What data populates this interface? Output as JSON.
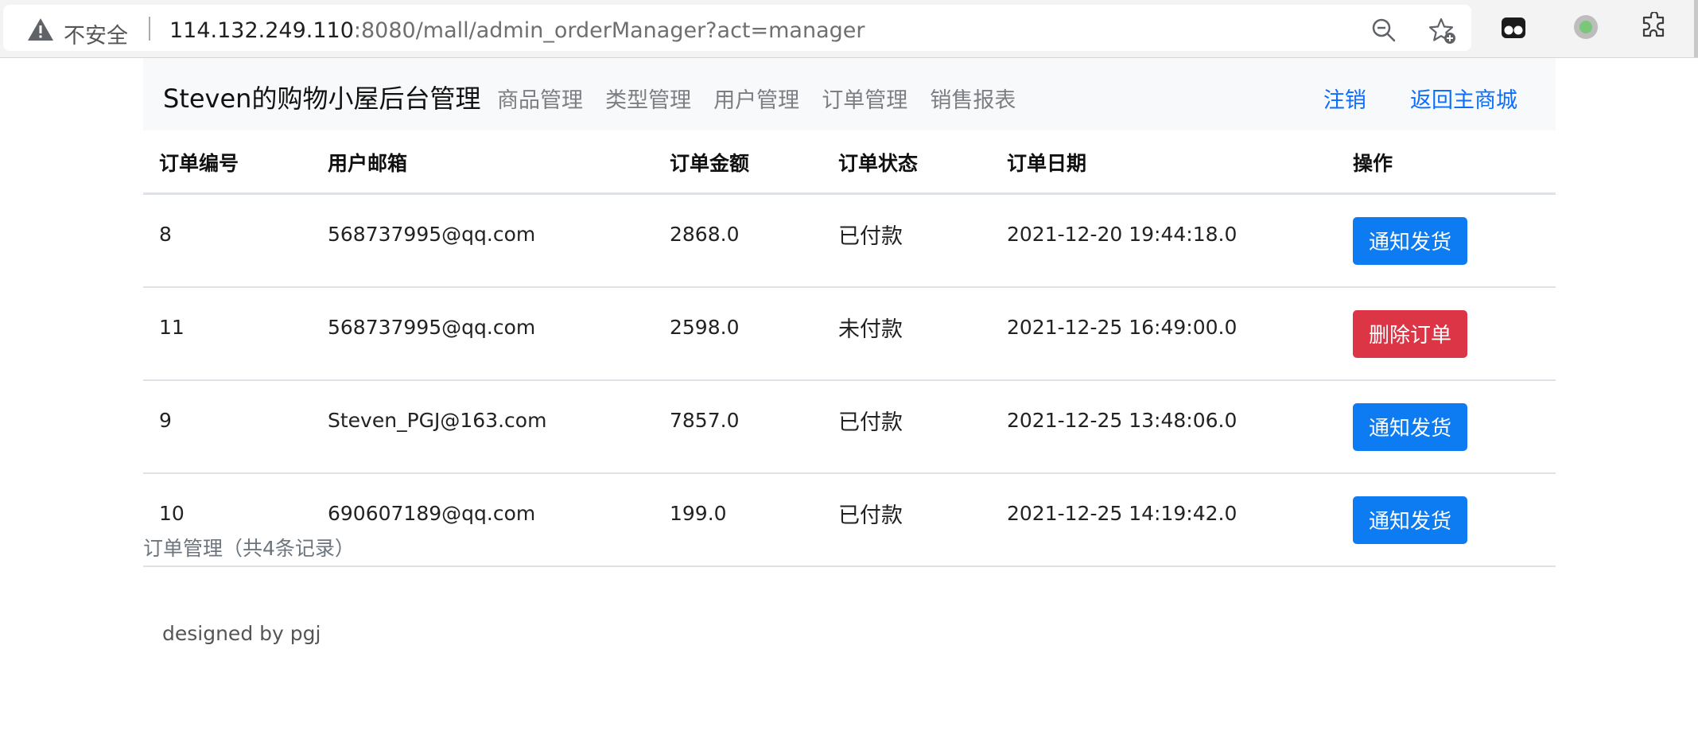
{
  "browser": {
    "security_label": "不安全",
    "url_host": "114.132.249.110",
    "url_rest": ":8080/mall/admin_orderManager?act=manager"
  },
  "nav": {
    "brand": "Steven的购物小屋后台管理",
    "links": [
      "商品管理",
      "类型管理",
      "用户管理",
      "订单管理",
      "销售报表"
    ],
    "logout": "注销",
    "back_to_mall": "返回主商城"
  },
  "table": {
    "headers": [
      "订单编号",
      "用户邮箱",
      "订单金额",
      "订单状态",
      "订单日期",
      "操作"
    ],
    "rows": [
      {
        "id": "8",
        "email": "568737995@qq.com",
        "amount": "2868.0",
        "status": "已付款",
        "date": "2021-12-20 19:44:18.0",
        "action": "通知发货",
        "action_type": "primary"
      },
      {
        "id": "11",
        "email": "568737995@qq.com",
        "amount": "2598.0",
        "status": "未付款",
        "date": "2021-12-25 16:49:00.0",
        "action": "删除订单",
        "action_type": "danger"
      },
      {
        "id": "9",
        "email": "Steven_PGJ@163.com",
        "amount": "7857.0",
        "status": "已付款",
        "date": "2021-12-25 13:48:06.0",
        "action": "通知发货",
        "action_type": "primary"
      },
      {
        "id": "10",
        "email": "690607189@qq.com",
        "amount": "199.0",
        "status": "已付款",
        "date": "2021-12-25 14:19:42.0",
        "action": "通知发货",
        "action_type": "primary"
      }
    ]
  },
  "summary": "订单管理（共4条记录）",
  "footer": "designed by pgj",
  "colors": {
    "primary": "#0d7cf2",
    "danger": "#dc3545",
    "link": "#0d6efd"
  },
  "icons": [
    "warning-icon",
    "zoom-out-icon",
    "favorite-add-icon",
    "extension-tab-icon",
    "extension-status-icon",
    "extensions-puzzle-icon"
  ]
}
